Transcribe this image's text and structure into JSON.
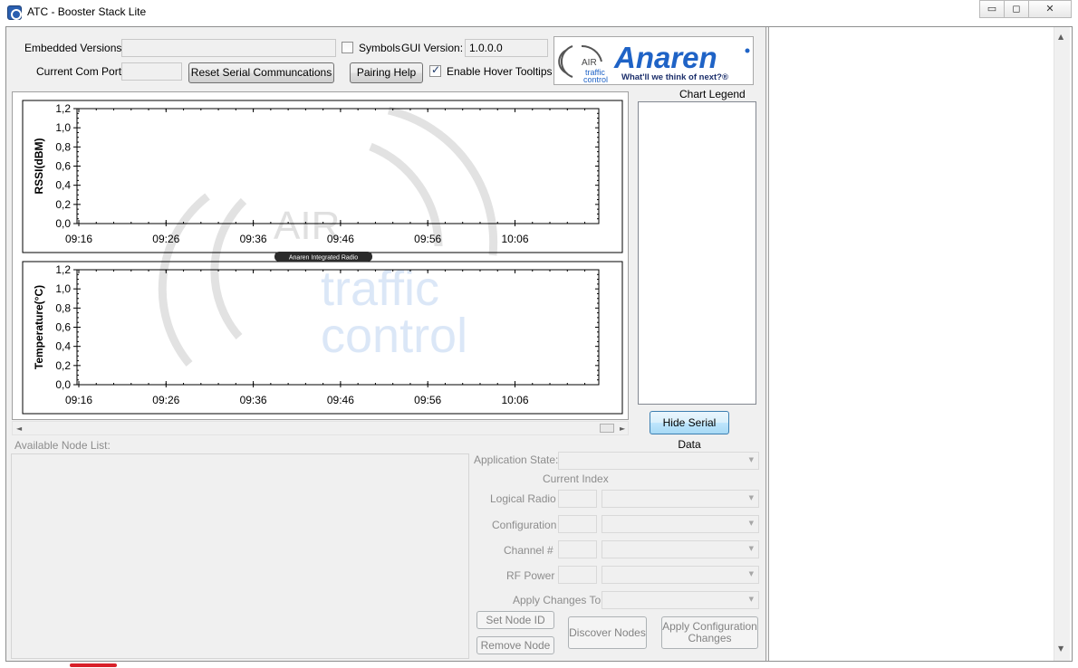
{
  "window": {
    "title": "ATC - Booster Stack Lite",
    "controls": {
      "minimize": "▭",
      "maximize": "◻",
      "close": "✕"
    }
  },
  "header": {
    "embedded_versions_label": "Embedded Versions:",
    "embedded_versions_value": "",
    "symbols_label": "Symbols",
    "symbols_checked": false,
    "gui_version_label": "GUI Version:",
    "gui_version_value": "1.0.0.0",
    "current_com_port_label": "Current Com Port:",
    "current_com_port_value": "",
    "reset_serial_button": "Reset Serial Communcations",
    "pairing_help_button": "Pairing Help",
    "hover_tooltips_label": "Enable Hover Tooltips",
    "hover_tooltips_checked": true
  },
  "logo": {
    "brand": "Anaren",
    "tagline": "What'll we think of next?®",
    "badge_top": "AIR",
    "badge_mid": "traffic",
    "badge_bot": "control"
  },
  "watermark": {
    "air": "AIR",
    "traffic": "traffic",
    "control": "control",
    "caption": "Anaren Integrated Radio"
  },
  "chart_data": [
    {
      "type": "line",
      "ylabel": "RSSI(dBM)",
      "yticks": [
        "0,0",
        "0,2",
        "0,4",
        "0,6",
        "0,8",
        "1,0",
        "1,2"
      ],
      "ylim": [
        0,
        1.2
      ],
      "xticks": [
        "09:16",
        "09:26",
        "09:36",
        "09:46",
        "09:56",
        "10:06"
      ],
      "series": []
    },
    {
      "type": "line",
      "ylabel": "Temperature(°C)",
      "yticks": [
        "0,0",
        "0,2",
        "0,4",
        "0,6",
        "0,8",
        "1,0",
        "1,2"
      ],
      "ylim": [
        0,
        1.2
      ],
      "xticks": [
        "09:16",
        "09:26",
        "09:36",
        "09:46",
        "09:56",
        "10:06"
      ],
      "series": []
    }
  ],
  "legend": {
    "title": "Chart Legend"
  },
  "hide_serial_button": "Hide Serial Data",
  "node_panel": {
    "available_node_list_label": "Available Node List:",
    "application_state_label": "Application State:",
    "current_index_label": "Current Index",
    "logical_radio_label": "Logical Radio",
    "configuration_label": "Configuration",
    "channel_label": "Channel #",
    "rf_power_label": "RF Power",
    "apply_changes_to_label": "Apply Changes To",
    "set_node_id_button": "Set Node ID",
    "remove_node_button": "Remove Node",
    "discover_nodes_button": "Discover Nodes",
    "apply_config_button_line1": "Apply Configuration",
    "apply_config_button_line2": "Changes"
  },
  "colors": {
    "brand_blue": "#1f63c6",
    "watermark_blue": "#d3e3f6",
    "accent_red": "#d8202a",
    "button_blue": "#bee6fd"
  },
  "icons": {
    "scroll_up": "▲",
    "scroll_down": "▼",
    "scroll_left": "◄",
    "scroll_right": "►"
  }
}
